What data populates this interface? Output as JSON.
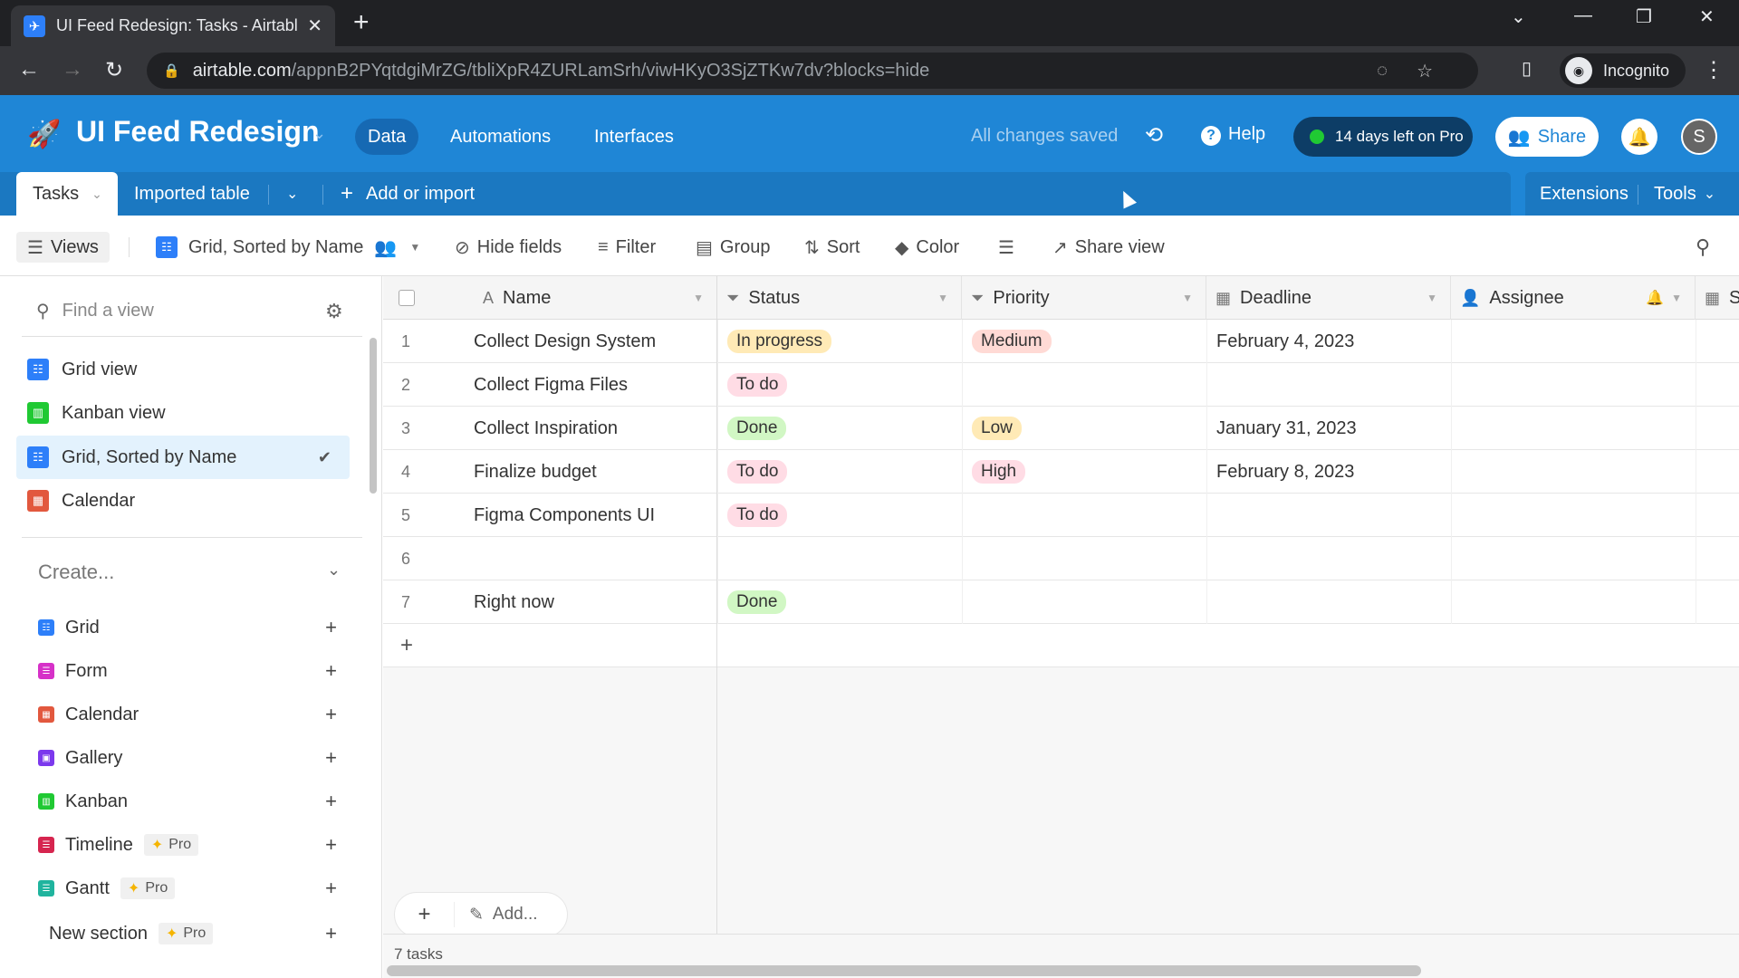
{
  "browser": {
    "tab_title": "UI Feed Redesign: Tasks - Airtable",
    "url_host": "airtable.com",
    "url_path": "/appnB2PYqtdgiMrZG/tbliXpR4ZURLamSrh/viwHKyO3SjZTKw7dv?blocks=hide",
    "profile_label": "Incognito"
  },
  "header": {
    "base_title": "UI Feed Redesign",
    "nav": [
      "Data",
      "Automations",
      "Interfaces"
    ],
    "saved_status": "All changes saved",
    "help_label": "Help",
    "trial_label": "14 days left on Pro",
    "share_label": "Share",
    "avatar_initial": "S"
  },
  "tables": {
    "active": "Tasks",
    "other": "Imported table",
    "add_label": "Add or import",
    "extensions_label": "Extensions",
    "tools_label": "Tools"
  },
  "toolbar": {
    "views_label": "Views",
    "current_view": "Grid, Sorted by Name",
    "hide_fields": "Hide fields",
    "filter": "Filter",
    "group": "Group",
    "sort": "Sort",
    "color": "Color",
    "share_view": "Share view"
  },
  "sidebar": {
    "find_placeholder": "Find a view",
    "views": [
      {
        "label": "Grid view",
        "type": "grid",
        "color": "#2d7ff9"
      },
      {
        "label": "Kanban view",
        "type": "kanban",
        "color": "#20c933"
      },
      {
        "label": "Grid, Sorted by Name",
        "type": "grid",
        "color": "#2d7ff9",
        "selected": true
      },
      {
        "label": "Calendar",
        "type": "calendar",
        "color": "#e2583e"
      }
    ],
    "create_label": "Create...",
    "create_items": [
      {
        "label": "Grid",
        "color": "#2d7ff9",
        "pro": false
      },
      {
        "label": "Form",
        "color": "#d631c8",
        "pro": false
      },
      {
        "label": "Calendar",
        "color": "#e2583e",
        "pro": false
      },
      {
        "label": "Gallery",
        "color": "#7c39ed",
        "pro": false
      },
      {
        "label": "Kanban",
        "color": "#20c933",
        "pro": false
      },
      {
        "label": "Timeline",
        "color": "#d6254f",
        "pro": true
      },
      {
        "label": "Gantt",
        "color": "#20b49e",
        "pro": true
      }
    ],
    "new_section_label": "New section",
    "pro_label": "Pro"
  },
  "grid": {
    "columns": [
      "Name",
      "Status",
      "Priority",
      "Deadline",
      "Assignee",
      "S"
    ],
    "rows": [
      {
        "n": "1",
        "name": "Collect Design System",
        "status": "In progress",
        "priority": "Medium",
        "deadline": "February 4, 2023"
      },
      {
        "n": "2",
        "name": "Collect Figma Files",
        "status": "To do",
        "priority": "",
        "deadline": ""
      },
      {
        "n": "3",
        "name": "Collect Inspiration",
        "status": "Done",
        "priority": "Low",
        "deadline": "January 31, 2023"
      },
      {
        "n": "4",
        "name": "Finalize budget",
        "status": "To do",
        "priority": "High",
        "deadline": "February 8, 2023"
      },
      {
        "n": "5",
        "name": "Figma Components UI",
        "status": "To do",
        "priority": "",
        "deadline": ""
      },
      {
        "n": "6",
        "name": "",
        "status": "",
        "priority": "",
        "deadline": ""
      },
      {
        "n": "7",
        "name": "Right now",
        "status": "Done",
        "priority": "",
        "deadline": ""
      }
    ],
    "chip_colors": {
      "In progress": "#ffeab6",
      "To do": "#ffdce5",
      "Done": "#d1f7c4",
      "Medium": "#ffdad5",
      "Low": "#ffeab6",
      "High": "#ffdce5"
    },
    "add_label": "Add...",
    "record_count": "7 tasks"
  }
}
